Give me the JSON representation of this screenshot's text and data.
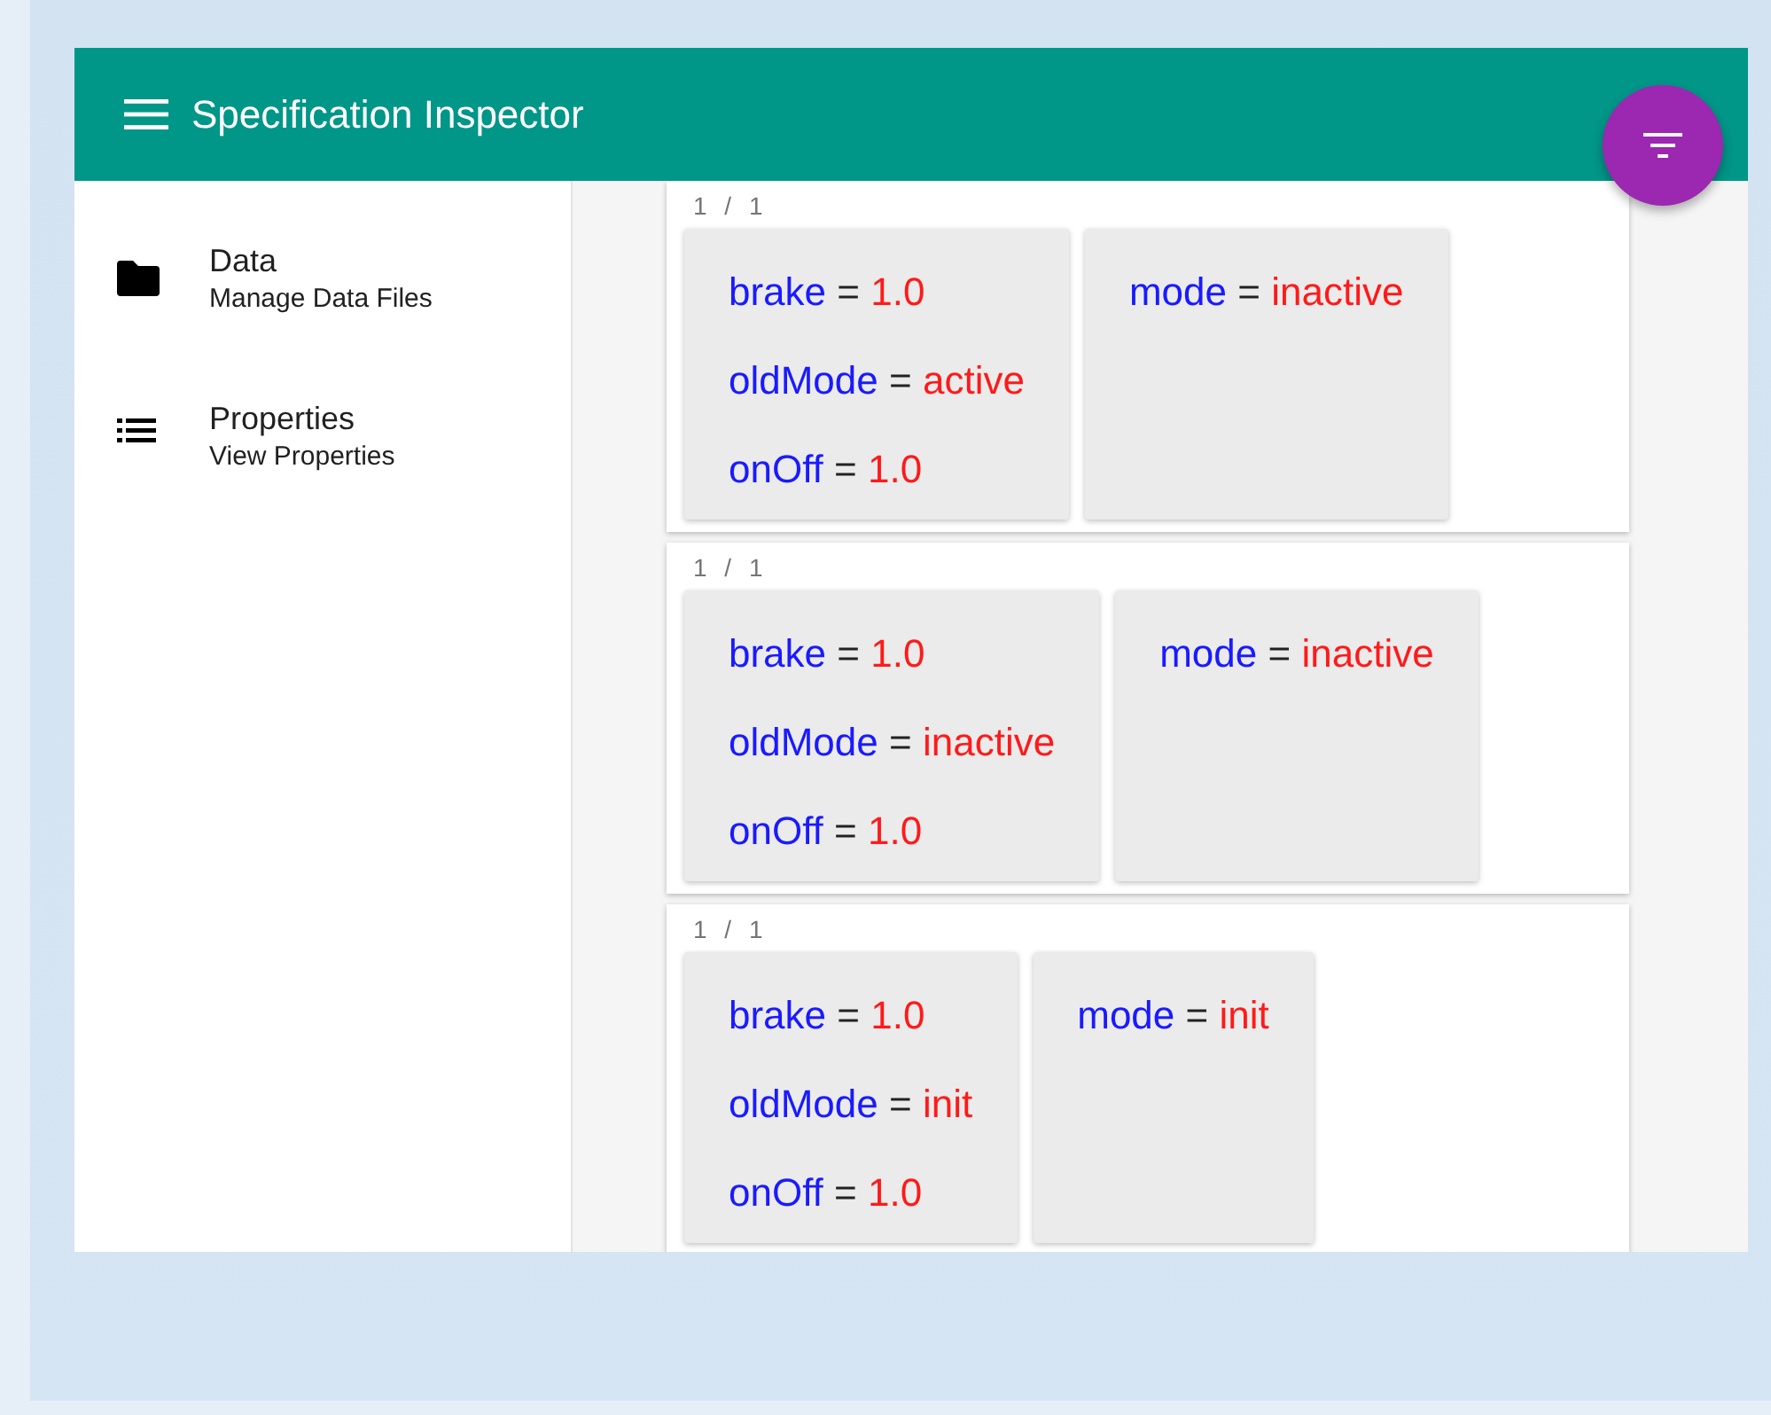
{
  "app_bar": {
    "title": "Specification Inspector"
  },
  "sidebar": {
    "items": [
      {
        "title": "Data",
        "subtitle": "Manage Data Files"
      },
      {
        "title": "Properties",
        "subtitle": "View Properties"
      }
    ]
  },
  "results": [
    {
      "counter": "1 / 1",
      "panels": [
        {
          "assignments": [
            {
              "name": "brake",
              "op": "=",
              "value": "1.0"
            },
            {
              "name": "oldMode",
              "op": "=",
              "value": "active"
            },
            {
              "name": "onOff",
              "op": "=",
              "value": "1.0"
            }
          ]
        },
        {
          "assignments": [
            {
              "name": "mode",
              "op": "=",
              "value": "inactive"
            }
          ]
        }
      ]
    },
    {
      "counter": "1 / 1",
      "panels": [
        {
          "assignments": [
            {
              "name": "brake",
              "op": "=",
              "value": "1.0"
            },
            {
              "name": "oldMode",
              "op": "=",
              "value": "inactive"
            },
            {
              "name": "onOff",
              "op": "=",
              "value": "1.0"
            }
          ]
        },
        {
          "assignments": [
            {
              "name": "mode",
              "op": "=",
              "value": "inactive"
            }
          ]
        }
      ]
    },
    {
      "counter": "1 / 1",
      "panels": [
        {
          "assignments": [
            {
              "name": "brake",
              "op": "=",
              "value": "1.0"
            },
            {
              "name": "oldMode",
              "op": "=",
              "value": "init"
            },
            {
              "name": "onOff",
              "op": "=",
              "value": "1.0"
            }
          ]
        },
        {
          "assignments": [
            {
              "name": "mode",
              "op": "=",
              "value": "init"
            }
          ]
        }
      ]
    }
  ]
}
